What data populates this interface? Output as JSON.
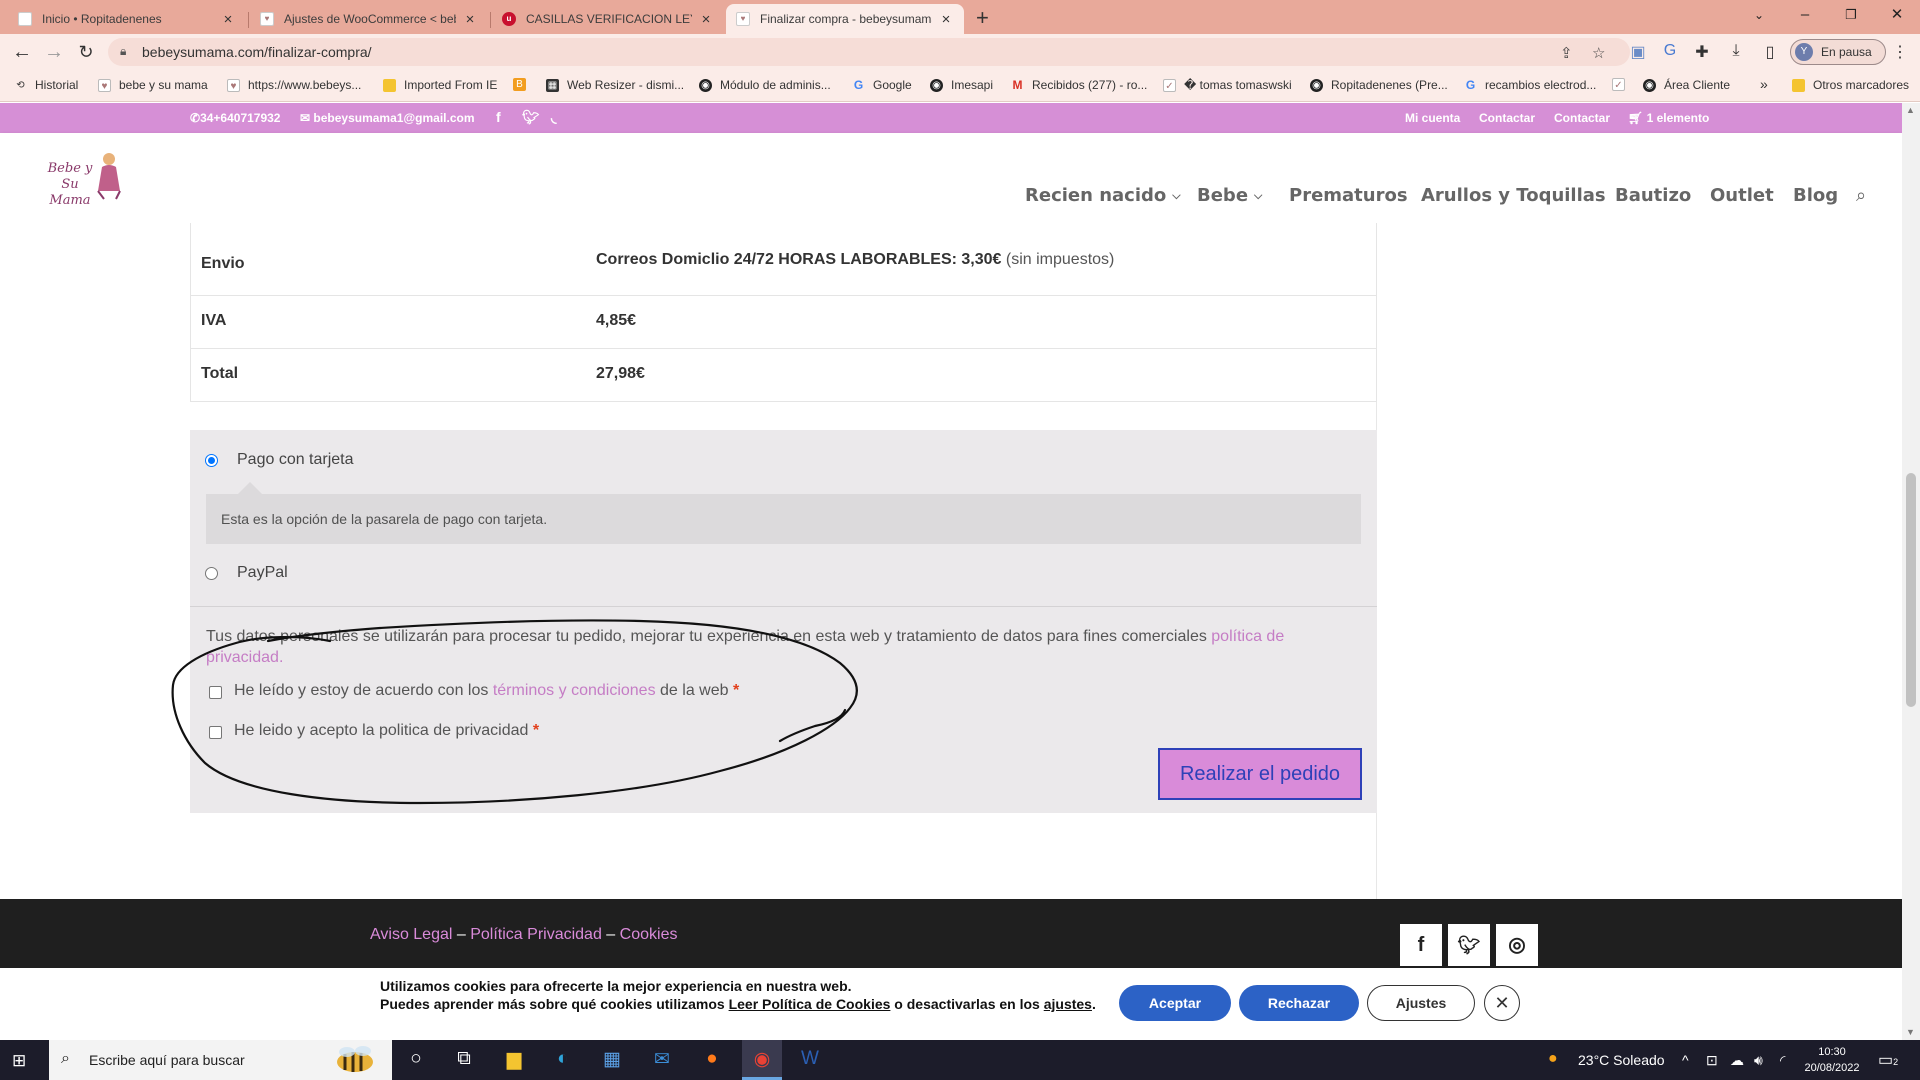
{
  "browser": {
    "tabs": [
      {
        "title": "Inicio • Ropitadenenes"
      },
      {
        "title": "Ajustes de WooCommerce < beb"
      },
      {
        "title": "CASILLAS VERIFICACION LEY PR"
      },
      {
        "title": "Finalizar compra - bebeysumama"
      }
    ],
    "new_tab": "+",
    "url": "bebeysumama.com/finalizar-compra/",
    "profile_initial": "Y",
    "profile_label": "En pausa",
    "bookmarks": [
      {
        "label": "Historial",
        "icon": "history-icon"
      },
      {
        "label": "bebe y su mama",
        "icon": "page-icon"
      },
      {
        "label": "https://www.bebeys...",
        "icon": "page-icon"
      },
      {
        "label": "Imported From IE",
        "icon": "folder-icon"
      },
      {
        "label": "",
        "icon": "blogger-icon"
      },
      {
        "label": "Web Resizer - dismi...",
        "icon": "web-icon"
      },
      {
        "label": "Módulo de adminis...",
        "icon": "globe-icon"
      },
      {
        "label": "Google",
        "icon": "google-icon"
      },
      {
        "label": "Imesapi",
        "icon": "globe-icon"
      },
      {
        "label": "Recibidos (277) - ro...",
        "icon": "gmail-icon"
      },
      {
        "label": "� tomas tomaswski",
        "icon": "page-icon"
      },
      {
        "label": "Ropitadenenes (Pre...",
        "icon": "globe-icon"
      },
      {
        "label": "recambios electrod...",
        "icon": "google-icon"
      },
      {
        "label": "",
        "icon": "page-icon"
      },
      {
        "label": "Área Cliente",
        "icon": "globe-icon"
      }
    ],
    "more_bookmarks": "»",
    "other_bookmarks": "Otros marcadores"
  },
  "site": {
    "topbar": {
      "phone": "34+640717932",
      "email": "bebeysumama1@gmail.com",
      "links": [
        "Mi cuenta",
        "Contactar",
        "Contactar"
      ],
      "cart": "1 elemento"
    },
    "logo_text": "Bebe y Su Mama",
    "nav": [
      {
        "label": "Recien nacido",
        "dropdown": true
      },
      {
        "label": "Bebe",
        "dropdown": true
      },
      {
        "label": "Prematuros"
      },
      {
        "label": "Arullos y Toquillas"
      },
      {
        "label": "Bautizo"
      },
      {
        "label": "Outlet"
      },
      {
        "label": "Blog"
      }
    ]
  },
  "order": {
    "rows": [
      {
        "label": "Envio",
        "value": "Correos Domiclio 24/72 HORAS LABORABLES: 3,30€",
        "extra": "(sin impuestos)"
      },
      {
        "label": "IVA",
        "value": "4,85€"
      },
      {
        "label": "Total",
        "value": "27,98€"
      }
    ]
  },
  "payment": {
    "card_label": "Pago con tarjeta",
    "card_desc": "Esta es la opción de la pasarela de pago con tarjeta.",
    "paypal_label": "PayPal",
    "privacy_text": "Tus datos personales se utilizarán para procesar tu pedido, mejorar tu experiencia en esta web y tratamiento de datos para fines comerciales ",
    "privacy_link": "política de privacidad",
    "privacy_end": ".",
    "terms_pre": "He leído y estoy de acuerdo con los ",
    "terms_link": "términos y condiciones",
    "terms_post": " de la web ",
    "privacy_check": "He leido y acepto la politica de privacidad ",
    "required_mark": "*",
    "place_order": "Realizar el pedido"
  },
  "footer": {
    "link1": "Aviso Legal",
    "sep": " – ",
    "link2": "Política Privacidad",
    "link3": "Cookies"
  },
  "cookies": {
    "line1": "Utilizamos cookies para ofrecerte la mejor experiencia en nuestra web.",
    "line2_pre": "Puedes aprender más sobre qué cookies utilizamos ",
    "line2_link": "Leer Política de Cookies",
    "line2_mid": " o desactivarlas en los ",
    "line2_link2": "ajustes",
    "line2_end": ".",
    "accept": "Aceptar",
    "reject": "Rechazar",
    "settings": "Ajustes"
  },
  "taskbar": {
    "search_placeholder": "Escribe aquí para buscar",
    "weather": "23°C  Soleado",
    "time": "10:30",
    "date": "20/08/2022",
    "notifications": "2"
  },
  "colors": {
    "brand_pink": "#d68fd6",
    "link_pink": "#c57dc5",
    "button_blue": "#2c62c6"
  }
}
